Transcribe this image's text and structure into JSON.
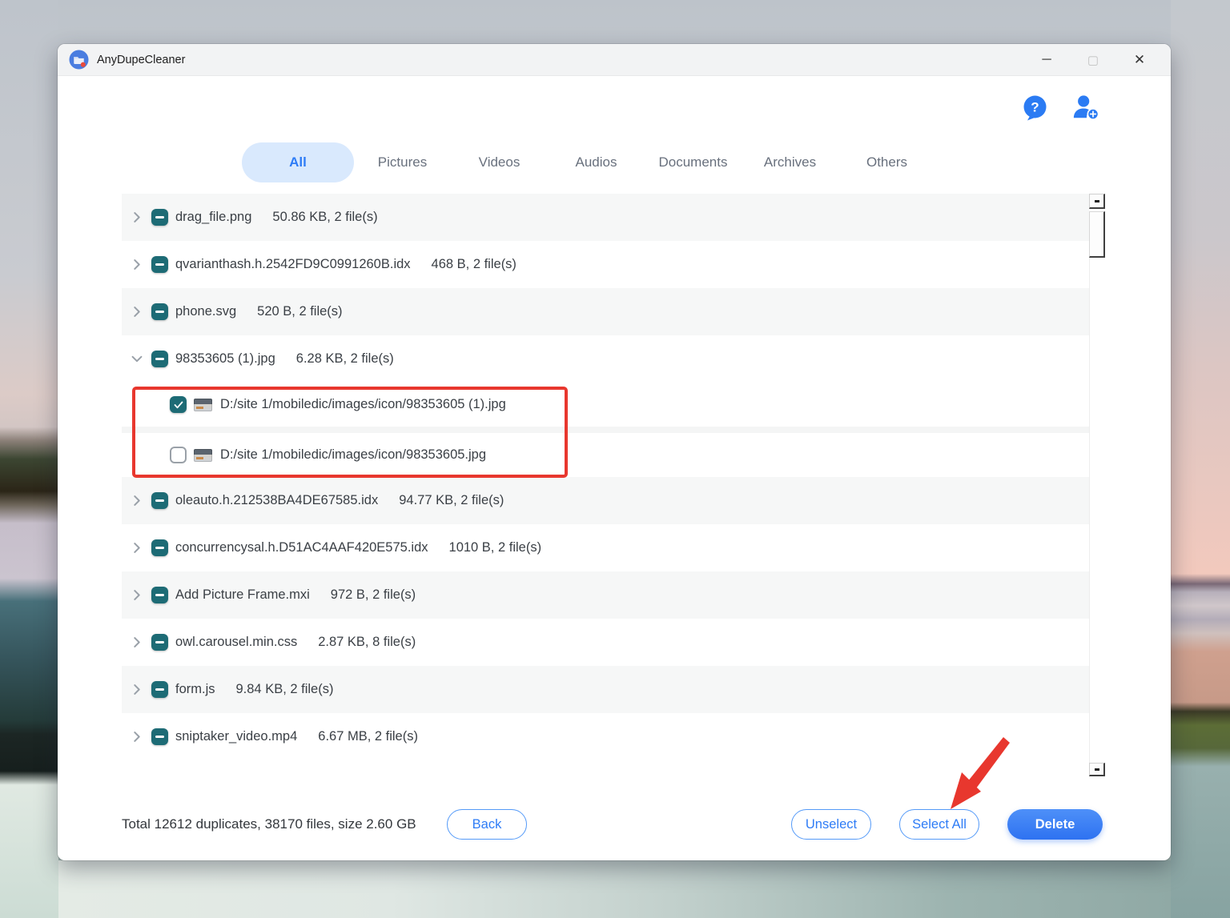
{
  "window": {
    "title": "AnyDupeCleaner"
  },
  "titlebar": {
    "minimize_glyph": "─",
    "maximize_glyph": "▢",
    "close_glyph": "✕"
  },
  "toolbar": {
    "icons": [
      "help-icon",
      "add-user-icon",
      "menu-icon"
    ]
  },
  "tabs": [
    {
      "label": "All",
      "active": true
    },
    {
      "label": "Pictures",
      "active": false
    },
    {
      "label": "Videos",
      "active": false
    },
    {
      "label": "Audios",
      "active": false
    },
    {
      "label": "Documents",
      "active": false
    },
    {
      "label": "Archives",
      "active": false
    },
    {
      "label": "Others",
      "active": false
    }
  ],
  "file_groups": [
    {
      "name": "drag_file.png",
      "meta": "50.86 KB, 2 file(s)",
      "expanded": false
    },
    {
      "name": "qvarianthash.h.2542FD9C0991260B.idx",
      "meta": "468 B, 2 file(s)",
      "expanded": false
    },
    {
      "name": "phone.svg",
      "meta": "520 B, 2 file(s)",
      "expanded": false
    },
    {
      "name": "98353605 (1).jpg",
      "meta": "6.28 KB, 2 file(s)",
      "expanded": true,
      "children": [
        {
          "path": "D:/site 1/mobiledic/images/icon/98353605 (1).jpg",
          "checked": true
        },
        {
          "path": "D:/site 1/mobiledic/images/icon/98353605.jpg",
          "checked": false
        }
      ]
    },
    {
      "name": "oleauto.h.212538BA4DE67585.idx",
      "meta": "94.77 KB, 2 file(s)",
      "expanded": false
    },
    {
      "name": "concurrencysal.h.D51AC4AAF420E575.idx",
      "meta": "1010 B, 2 file(s)",
      "expanded": false
    },
    {
      "name": "Add Picture Frame.mxi",
      "meta": "972 B, 2 file(s)",
      "expanded": false
    },
    {
      "name": "owl.carousel.min.css",
      "meta": "2.87 KB, 8 file(s)",
      "expanded": false
    },
    {
      "name": "form.js",
      "meta": "9.84 KB, 2 file(s)",
      "expanded": false
    },
    {
      "name": "sniptaker_video.mp4",
      "meta": "6.67 MB, 2 file(s)",
      "expanded": false
    }
  ],
  "footer": {
    "summary": "Total 12612 duplicates, 38170 files, size 2.60 GB",
    "back_label": "Back",
    "unselect_label": "Unselect",
    "select_all_label": "Select All",
    "delete_label": "Delete"
  },
  "colors": {
    "accent_blue": "#2e7cf6",
    "checkbox_teal": "#1d6b75",
    "annotation_red": "#e8372e",
    "active_tab_bg": "#d9e9fd",
    "row_stripe": "#f6f7f7"
  }
}
